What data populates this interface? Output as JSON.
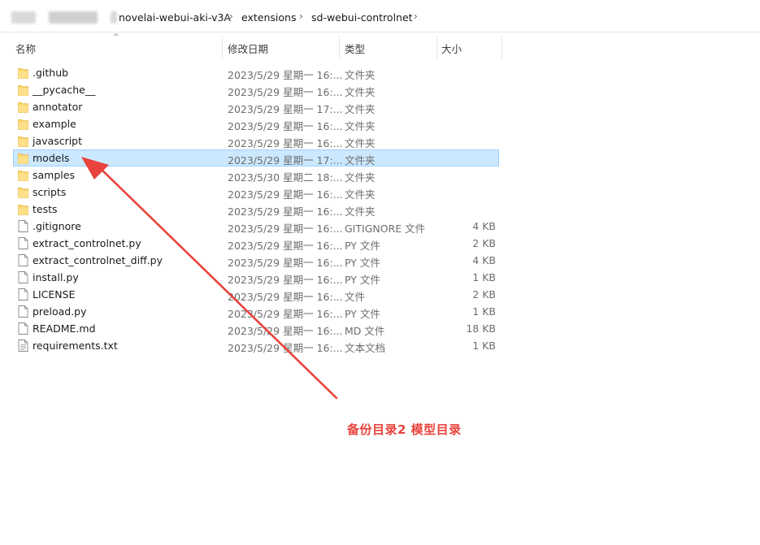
{
  "breadcrumb": {
    "items": [
      {
        "label": "novelai-webui-aki-v3A"
      },
      {
        "label": "extensions"
      },
      {
        "label": "sd-webui-controlnet"
      }
    ],
    "separator": "›"
  },
  "columns": {
    "name": "名称",
    "date": "修改日期",
    "type": "类型",
    "size": "大小",
    "sort_indicator": "^"
  },
  "files": [
    {
      "name": ".github",
      "date": "2023/5/29 星期一 16:...",
      "type": "文件夹",
      "size": "",
      "kind": "folder"
    },
    {
      "name": "__pycache__",
      "date": "2023/5/29 星期一 16:...",
      "type": "文件夹",
      "size": "",
      "kind": "folder"
    },
    {
      "name": "annotator",
      "date": "2023/5/29 星期一 17:...",
      "type": "文件夹",
      "size": "",
      "kind": "folder"
    },
    {
      "name": "example",
      "date": "2023/5/29 星期一 16:...",
      "type": "文件夹",
      "size": "",
      "kind": "folder"
    },
    {
      "name": "javascript",
      "date": "2023/5/29 星期一 16:...",
      "type": "文件夹",
      "size": "",
      "kind": "folder"
    },
    {
      "name": "models",
      "date": "2023/5/29 星期一 17:...",
      "type": "文件夹",
      "size": "",
      "kind": "folder",
      "selected": true
    },
    {
      "name": "samples",
      "date": "2023/5/30 星期二 18:...",
      "type": "文件夹",
      "size": "",
      "kind": "folder"
    },
    {
      "name": "scripts",
      "date": "2023/5/29 星期一 16:...",
      "type": "文件夹",
      "size": "",
      "kind": "folder"
    },
    {
      "name": "tests",
      "date": "2023/5/29 星期一 16:...",
      "type": "文件夹",
      "size": "",
      "kind": "folder"
    },
    {
      "name": ".gitignore",
      "date": "2023/5/29 星期一 16:...",
      "type": "GITIGNORE 文件",
      "size": "4 KB",
      "kind": "file"
    },
    {
      "name": "extract_controlnet.py",
      "date": "2023/5/29 星期一 16:...",
      "type": "PY 文件",
      "size": "2 KB",
      "kind": "file"
    },
    {
      "name": "extract_controlnet_diff.py",
      "date": "2023/5/29 星期一 16:...",
      "type": "PY 文件",
      "size": "4 KB",
      "kind": "file"
    },
    {
      "name": "install.py",
      "date": "2023/5/29 星期一 16:...",
      "type": "PY 文件",
      "size": "1 KB",
      "kind": "file"
    },
    {
      "name": "LICENSE",
      "date": "2023/5/29 星期一 16:...",
      "type": "文件",
      "size": "2 KB",
      "kind": "file"
    },
    {
      "name": "preload.py",
      "date": "2023/5/29 星期一 16:...",
      "type": "PY 文件",
      "size": "1 KB",
      "kind": "file"
    },
    {
      "name": "README.md",
      "date": "2023/5/29 星期一 16:...",
      "type": "MD 文件",
      "size": "18 KB",
      "kind": "file"
    },
    {
      "name": "requirements.txt",
      "date": "2023/5/29 星期一 16:...",
      "type": "文本文档",
      "size": "1 KB",
      "kind": "textfile"
    }
  ],
  "annotation": {
    "text": "备份目录2  模型目录",
    "color": "#e8433c"
  },
  "colors": {
    "selection_bg": "#cce8ff",
    "selection_border": "#99d1ff",
    "folder_yellow": "#ffd766"
  }
}
